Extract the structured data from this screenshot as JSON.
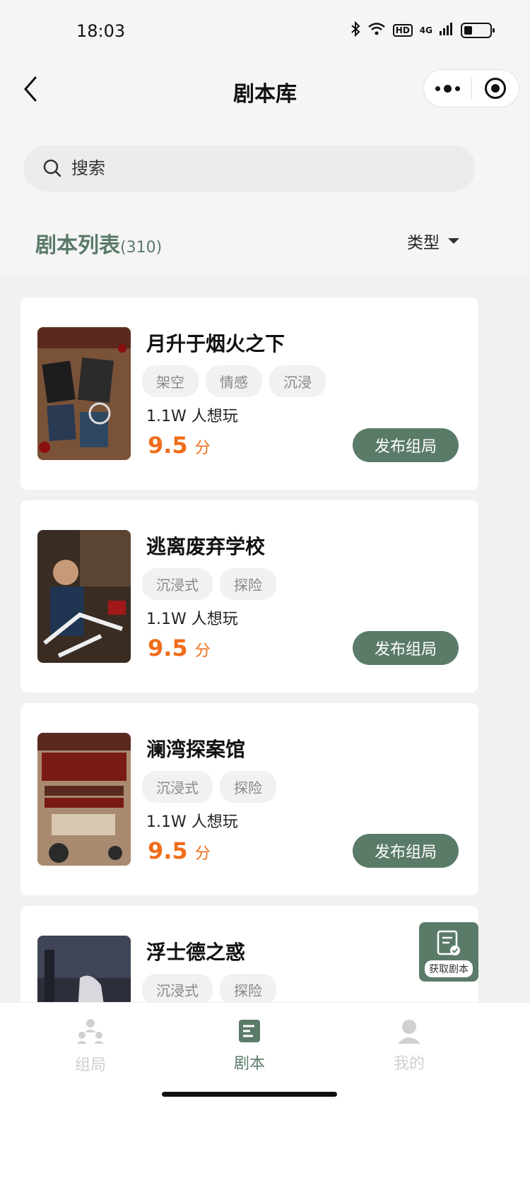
{
  "status_bar": {
    "time": "18:03",
    "network": "4G",
    "hd": "HD"
  },
  "nav": {
    "title": "剧本库"
  },
  "search": {
    "placeholder": "搜索"
  },
  "list_header": {
    "title": "剧本列表",
    "count": "(310)",
    "filter_label": "类型"
  },
  "scripts": [
    {
      "title": "月升于烟火之下",
      "tags": [
        "架空",
        "情感",
        "沉浸"
      ],
      "players": "1.1W 人想玩",
      "score": "9.5",
      "score_unit": "分",
      "button": "发布组局"
    },
    {
      "title": "逃离废弃学校",
      "tags": [
        "沉浸式",
        "探险"
      ],
      "players": "1.1W 人想玩",
      "score": "9.5",
      "score_unit": "分",
      "button": "发布组局"
    },
    {
      "title": "澜湾探案馆",
      "tags": [
        "沉浸式",
        "探险"
      ],
      "players": "1.1W 人想玩",
      "score": "9.5",
      "score_unit": "分",
      "button": "发布组局"
    },
    {
      "title": "浮士德之惑",
      "tags": [
        "沉浸式",
        "探险"
      ]
    }
  ],
  "fab": {
    "label": "获取剧本"
  },
  "tabs": [
    {
      "label": "组局",
      "icon": "people-icon"
    },
    {
      "label": "剧本",
      "icon": "script-icon"
    },
    {
      "label": "我的",
      "icon": "user-icon"
    }
  ],
  "colors": {
    "accent": "#5b7b69",
    "score": "#f06d1a"
  }
}
